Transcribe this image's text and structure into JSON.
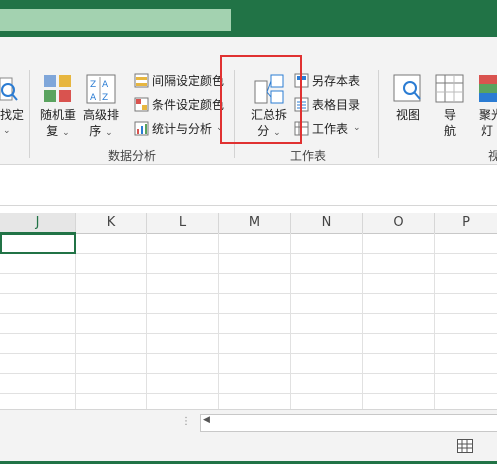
{
  "ribbon": {
    "left_cut_label_1": "找定",
    "random_button": {
      "line1": "随机重",
      "line2": "复"
    },
    "sort_button": {
      "line1": "高级排",
      "line2": "序"
    },
    "interval_color": "间隔设定颜色",
    "condition_color": "条件设定颜色",
    "stats_analysis": "统计与分析",
    "group_data_analysis": "数据分析",
    "summary_split": {
      "line1": "汇总拆",
      "line2": "分"
    },
    "save_as_table": "另存本表",
    "table_directory": "表格目录",
    "worksheet": "工作表",
    "group_worksheet": "工作表",
    "view_button": "视图",
    "nav_button": {
      "line1": "导",
      "line2": "航"
    },
    "spotlight_button": {
      "line1": "聚光",
      "line2": "灯"
    },
    "group_cut_label": "视"
  },
  "grid": {
    "columns": [
      "J",
      "K",
      "L",
      "M",
      "N",
      "O",
      "P"
    ],
    "selected_cell": "J1"
  },
  "colors": {
    "brand": "#217346",
    "highlight_box": "#e03131"
  }
}
